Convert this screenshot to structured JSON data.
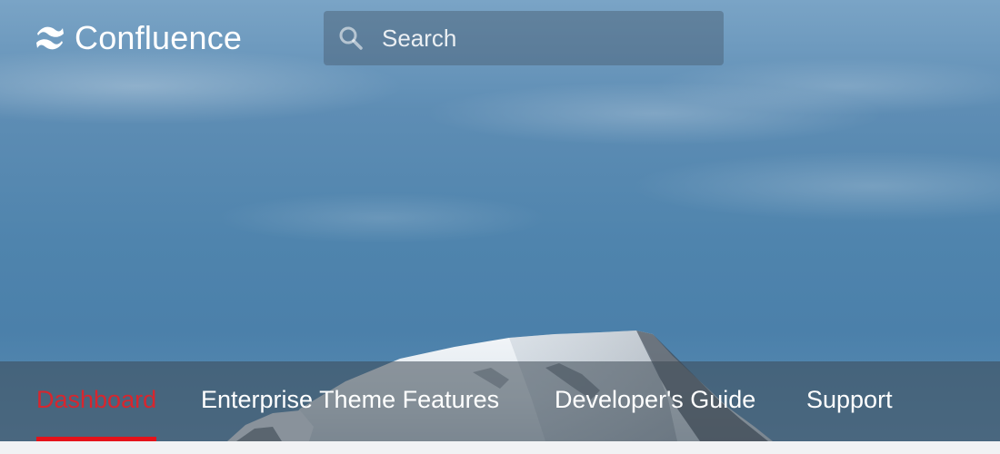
{
  "header": {
    "logo_text": "Confluence",
    "logo_icon": "confluence-logo-icon",
    "search": {
      "placeholder": "Search",
      "value": "",
      "icon": "search-icon"
    }
  },
  "nav": {
    "active_color": "#d7262e",
    "items": [
      {
        "label": "Dashboard",
        "active": true
      },
      {
        "label": "Enterprise Theme Features",
        "active": false
      },
      {
        "label": "Developer's Guide",
        "active": false
      },
      {
        "label": "Support",
        "active": false
      }
    ]
  }
}
